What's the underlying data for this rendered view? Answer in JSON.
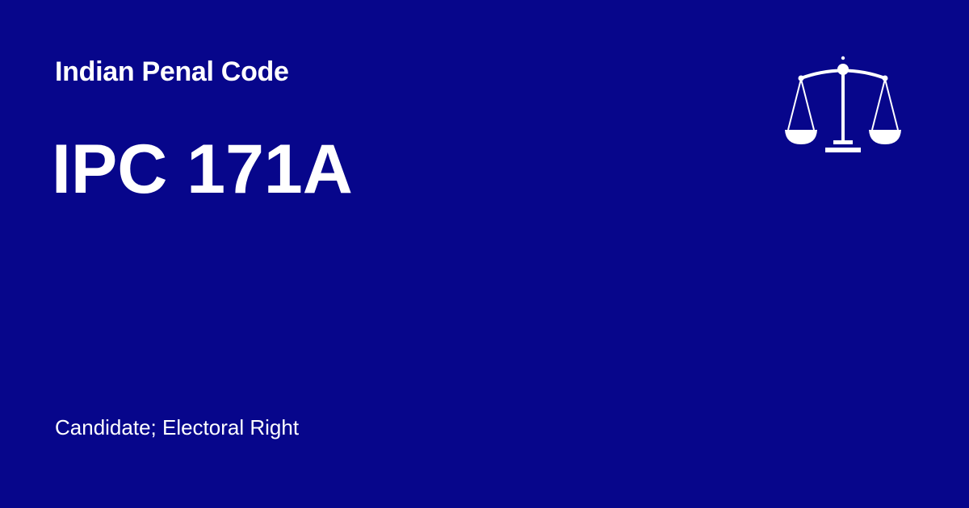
{
  "header": {
    "subtitle": "Indian Penal Code",
    "title": "IPC 171A"
  },
  "footer": {
    "tagline": "Candidate; Electoral Right"
  },
  "logo": {
    "icon": "scales-of-justice-icon"
  },
  "colors": {
    "background": "#07068b",
    "text": "#ffffff"
  }
}
